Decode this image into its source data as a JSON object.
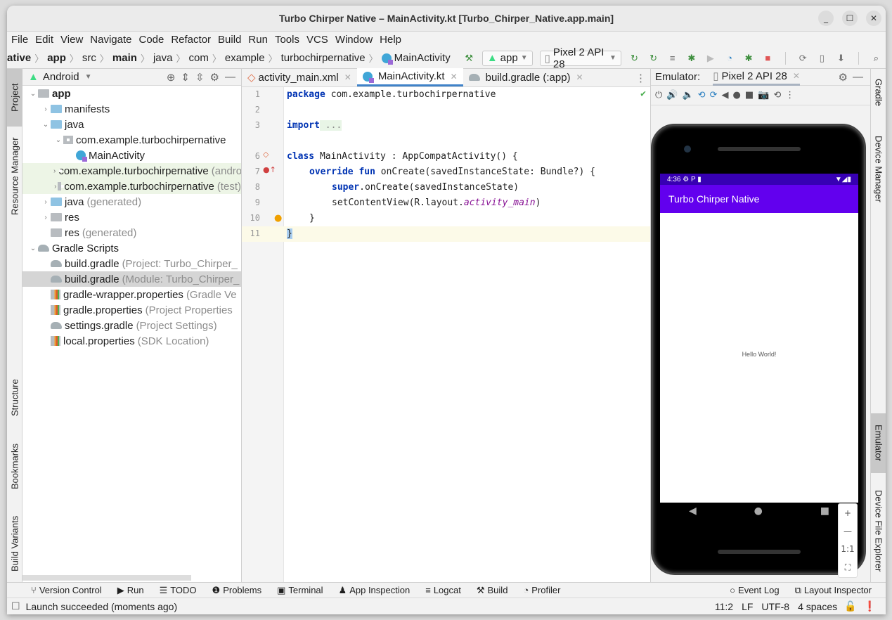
{
  "window": {
    "title": "Turbo Chirper Native – MainActivity.kt [Turbo_Chirper_Native.app.main]",
    "controls": {
      "minimize": "—",
      "maximize": "☐",
      "close": "✕"
    }
  },
  "menu": [
    "File",
    "Edit",
    "View",
    "Navigate",
    "Code",
    "Refactor",
    "Build",
    "Run",
    "Tools",
    "VCS",
    "Window",
    "Help"
  ],
  "breadcrumb": [
    "ative",
    "app",
    "src",
    "main",
    "java",
    "com",
    "example",
    "turbochirpernative",
    "MainActivity"
  ],
  "toolbar": {
    "run_config": "app",
    "device": "Pixel 2 API 28",
    "icons": [
      "hammer-icon",
      "apply-changes-icon",
      "apply-code-changes-icon",
      "run-coverage-icon",
      "debug-icon",
      "attach-debugger-icon",
      "profile-icon",
      "debug-attach-icon",
      "stop-icon",
      "sync-gradle-icon",
      "avd-manager-icon",
      "sdk-manager-icon",
      "search-icon",
      "settings-icon",
      "account-icon"
    ]
  },
  "left_strip": {
    "project": "Project",
    "resource_manager": "Resource Manager",
    "structure": "Structure",
    "bookmarks": "Bookmarks",
    "build_variants": "Build Variants"
  },
  "right_strip": {
    "gradle": "Gradle",
    "device_manager": "Device Manager",
    "emulator": "Emulator",
    "device_file_explorer": "Device File Explorer"
  },
  "project": {
    "view_mode": "Android",
    "tree": [
      {
        "label": "app",
        "hint": "",
        "level": 0,
        "expanded": true,
        "icon": "module"
      },
      {
        "label": "manifests",
        "hint": "",
        "level": 1,
        "expanded": false,
        "icon": "folder"
      },
      {
        "label": "java",
        "hint": "",
        "level": 1,
        "expanded": true,
        "icon": "folder"
      },
      {
        "label": "com.example.turbochirpernative",
        "hint": "",
        "level": 2,
        "expanded": true,
        "icon": "package"
      },
      {
        "label": "MainActivity",
        "hint": "",
        "level": 3,
        "icon": "kotlin-class"
      },
      {
        "label": "com.example.turbochirpernative",
        "hint": "(androidTest)",
        "level": 2,
        "expanded": false,
        "icon": "package"
      },
      {
        "label": "com.example.turbochirpernative",
        "hint": "(test)",
        "level": 2,
        "expanded": false,
        "icon": "package"
      },
      {
        "label": "java",
        "hint": "(generated)",
        "level": 1,
        "expanded": false,
        "icon": "folder-generated"
      },
      {
        "label": "res",
        "hint": "",
        "level": 1,
        "expanded": false,
        "icon": "res"
      },
      {
        "label": "res",
        "hint": "(generated)",
        "level": 1,
        "icon": "res"
      },
      {
        "label": "Gradle Scripts",
        "hint": "",
        "level": 0,
        "expanded": true,
        "icon": "gradle"
      },
      {
        "label": "build.gradle",
        "hint": "(Project: Turbo_Chirper_",
        "level": 1,
        "icon": "gradle"
      },
      {
        "label": "build.gradle",
        "hint": "(Module: Turbo_Chirper_",
        "level": 1,
        "icon": "gradle",
        "selected": true
      },
      {
        "label": "gradle-wrapper.properties",
        "hint": "(Gradle Ve",
        "level": 1,
        "icon": "properties"
      },
      {
        "label": "gradle.properties",
        "hint": "(Project Properties",
        "level": 1,
        "icon": "properties"
      },
      {
        "label": "settings.gradle",
        "hint": "(Project Settings)",
        "level": 1,
        "icon": "gradle"
      },
      {
        "label": "local.properties",
        "hint": "(SDK Location)",
        "level": 1,
        "icon": "properties"
      }
    ]
  },
  "editor": {
    "tabs": [
      {
        "label": "activity_main.xml",
        "icon": "xml"
      },
      {
        "label": "MainActivity.kt",
        "icon": "kotlin",
        "active": true
      },
      {
        "label": "build.gradle (:app)",
        "icon": "gradle"
      }
    ],
    "line_numbers": [
      "1",
      "2",
      "3",
      "6",
      "7",
      "8",
      "9",
      "10",
      "11"
    ],
    "lines": [
      {
        "n": "1",
        "kw": "package",
        "rest": " com.example.turbochirpernative"
      },
      {
        "n": "2",
        "kw": "",
        "rest": ""
      },
      {
        "n": "3",
        "kw": "import",
        "rest": " ..."
      },
      {
        "n": "6",
        "kw": "class",
        "rest": " MainActivity : AppCompatActivity() {"
      },
      {
        "n": "7",
        "kw": "override fun",
        "rest": " onCreate(savedInstanceState: Bundle?) {"
      },
      {
        "n": "8",
        "kw": "super",
        "rest": ".onCreate(savedInstanceState)"
      },
      {
        "n": "9",
        "kw": "",
        "rest": "setContentView(R.layout.",
        "italic": "activity_main",
        "tail": ")"
      },
      {
        "n": "10",
        "kw": "",
        "rest": "}"
      },
      {
        "n": "11",
        "kw": "",
        "rest": "}"
      }
    ]
  },
  "emulator": {
    "label": "Emulator:",
    "device_tab": "Pixel 2 API 28",
    "controls": [
      "power-icon",
      "volume-up-icon",
      "volume-down-icon",
      "rotate-left-icon",
      "rotate-right-icon",
      "back-icon",
      "home-icon",
      "overview-icon",
      "screenshot-icon",
      "snapshot-icon",
      "more-icon"
    ],
    "phone": {
      "time": "4:36",
      "app_title": "Turbo Chirper Native",
      "body_text": "Hello World!",
      "statusbar_color": "#3700b3",
      "appbar_color": "#6200ee"
    },
    "zoom": {
      "in": "+",
      "out": "—",
      "actual": "1:1",
      "fit": "⛶"
    }
  },
  "bottom_tabs": {
    "left": [
      "Version Control",
      "Run",
      "TODO",
      "Problems",
      "Terminal",
      "App Inspection",
      "Logcat",
      "Build",
      "Profiler"
    ],
    "right": [
      "Event Log",
      "Layout Inspector"
    ]
  },
  "status": {
    "message": "Launch succeeded (moments ago)",
    "position": "11:2",
    "line_sep": "LF",
    "encoding": "UTF-8",
    "indent": "4 spaces"
  }
}
